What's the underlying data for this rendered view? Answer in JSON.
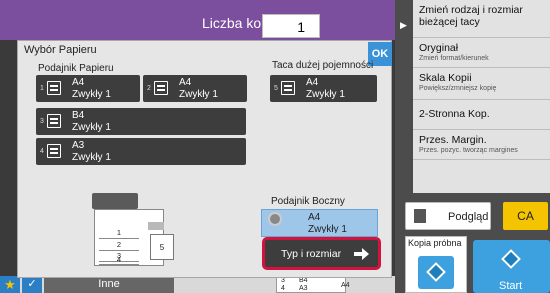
{
  "header": {
    "copies_label": "Liczba kopii",
    "copies_value": "1",
    "accent_color": "#7c4e9e"
  },
  "right_menu": {
    "items": [
      {
        "title": "Zmień rodzaj i rozmiar bieżącej tacy",
        "subtitle": ""
      },
      {
        "title": "Oryginał",
        "subtitle": "Zmień format/kierunek"
      },
      {
        "title": "Skala Kopii",
        "subtitle": "Powiększ/zmniejsz kopię"
      },
      {
        "title": "2-Stronna Kop.",
        "subtitle": ""
      },
      {
        "title": "Przes. Margin.",
        "subtitle": "Przes. pozyc. tworząc margines"
      }
    ],
    "preview_label": "Podgląd",
    "ca_label": "CA",
    "proof_copy_label": "Kopia próbna",
    "start_label": "Start",
    "start_color": "#3ea1df",
    "ca_color": "#f4c400"
  },
  "dialog": {
    "title": "Wybór Papieru",
    "ok_label": "OK",
    "paper_trays_label": "Podajnik Papieru",
    "trays": [
      {
        "num": "1",
        "size": "A4",
        "type": "Zwykły 1"
      },
      {
        "num": "2",
        "size": "A4",
        "type": "Zwykły 1"
      },
      {
        "num": "3",
        "size": "B4",
        "type": "Zwykły 1"
      },
      {
        "num": "4",
        "size": "A3",
        "type": "Zwykły 1"
      }
    ],
    "lct_label": "Taca dużej pojemności",
    "lct_tray": {
      "num": "5",
      "size": "A4",
      "type": "Zwykły 1"
    },
    "bypass_label": "Podajnik Boczny",
    "bypass_tray": {
      "size": "A4",
      "type": "Zwykły 1"
    },
    "type_size_button": "Typ i rozmiar",
    "highlight_color": "#d4123e",
    "machine": {
      "drawers": [
        "1",
        "2",
        "3",
        "4"
      ],
      "side": "5"
    }
  },
  "bottom_bar": {
    "other_label": "Inne",
    "mini_tray": {
      "r1": "B4",
      "r2": "A3",
      "n3": "3",
      "n4": "4",
      "right": "A4"
    }
  }
}
